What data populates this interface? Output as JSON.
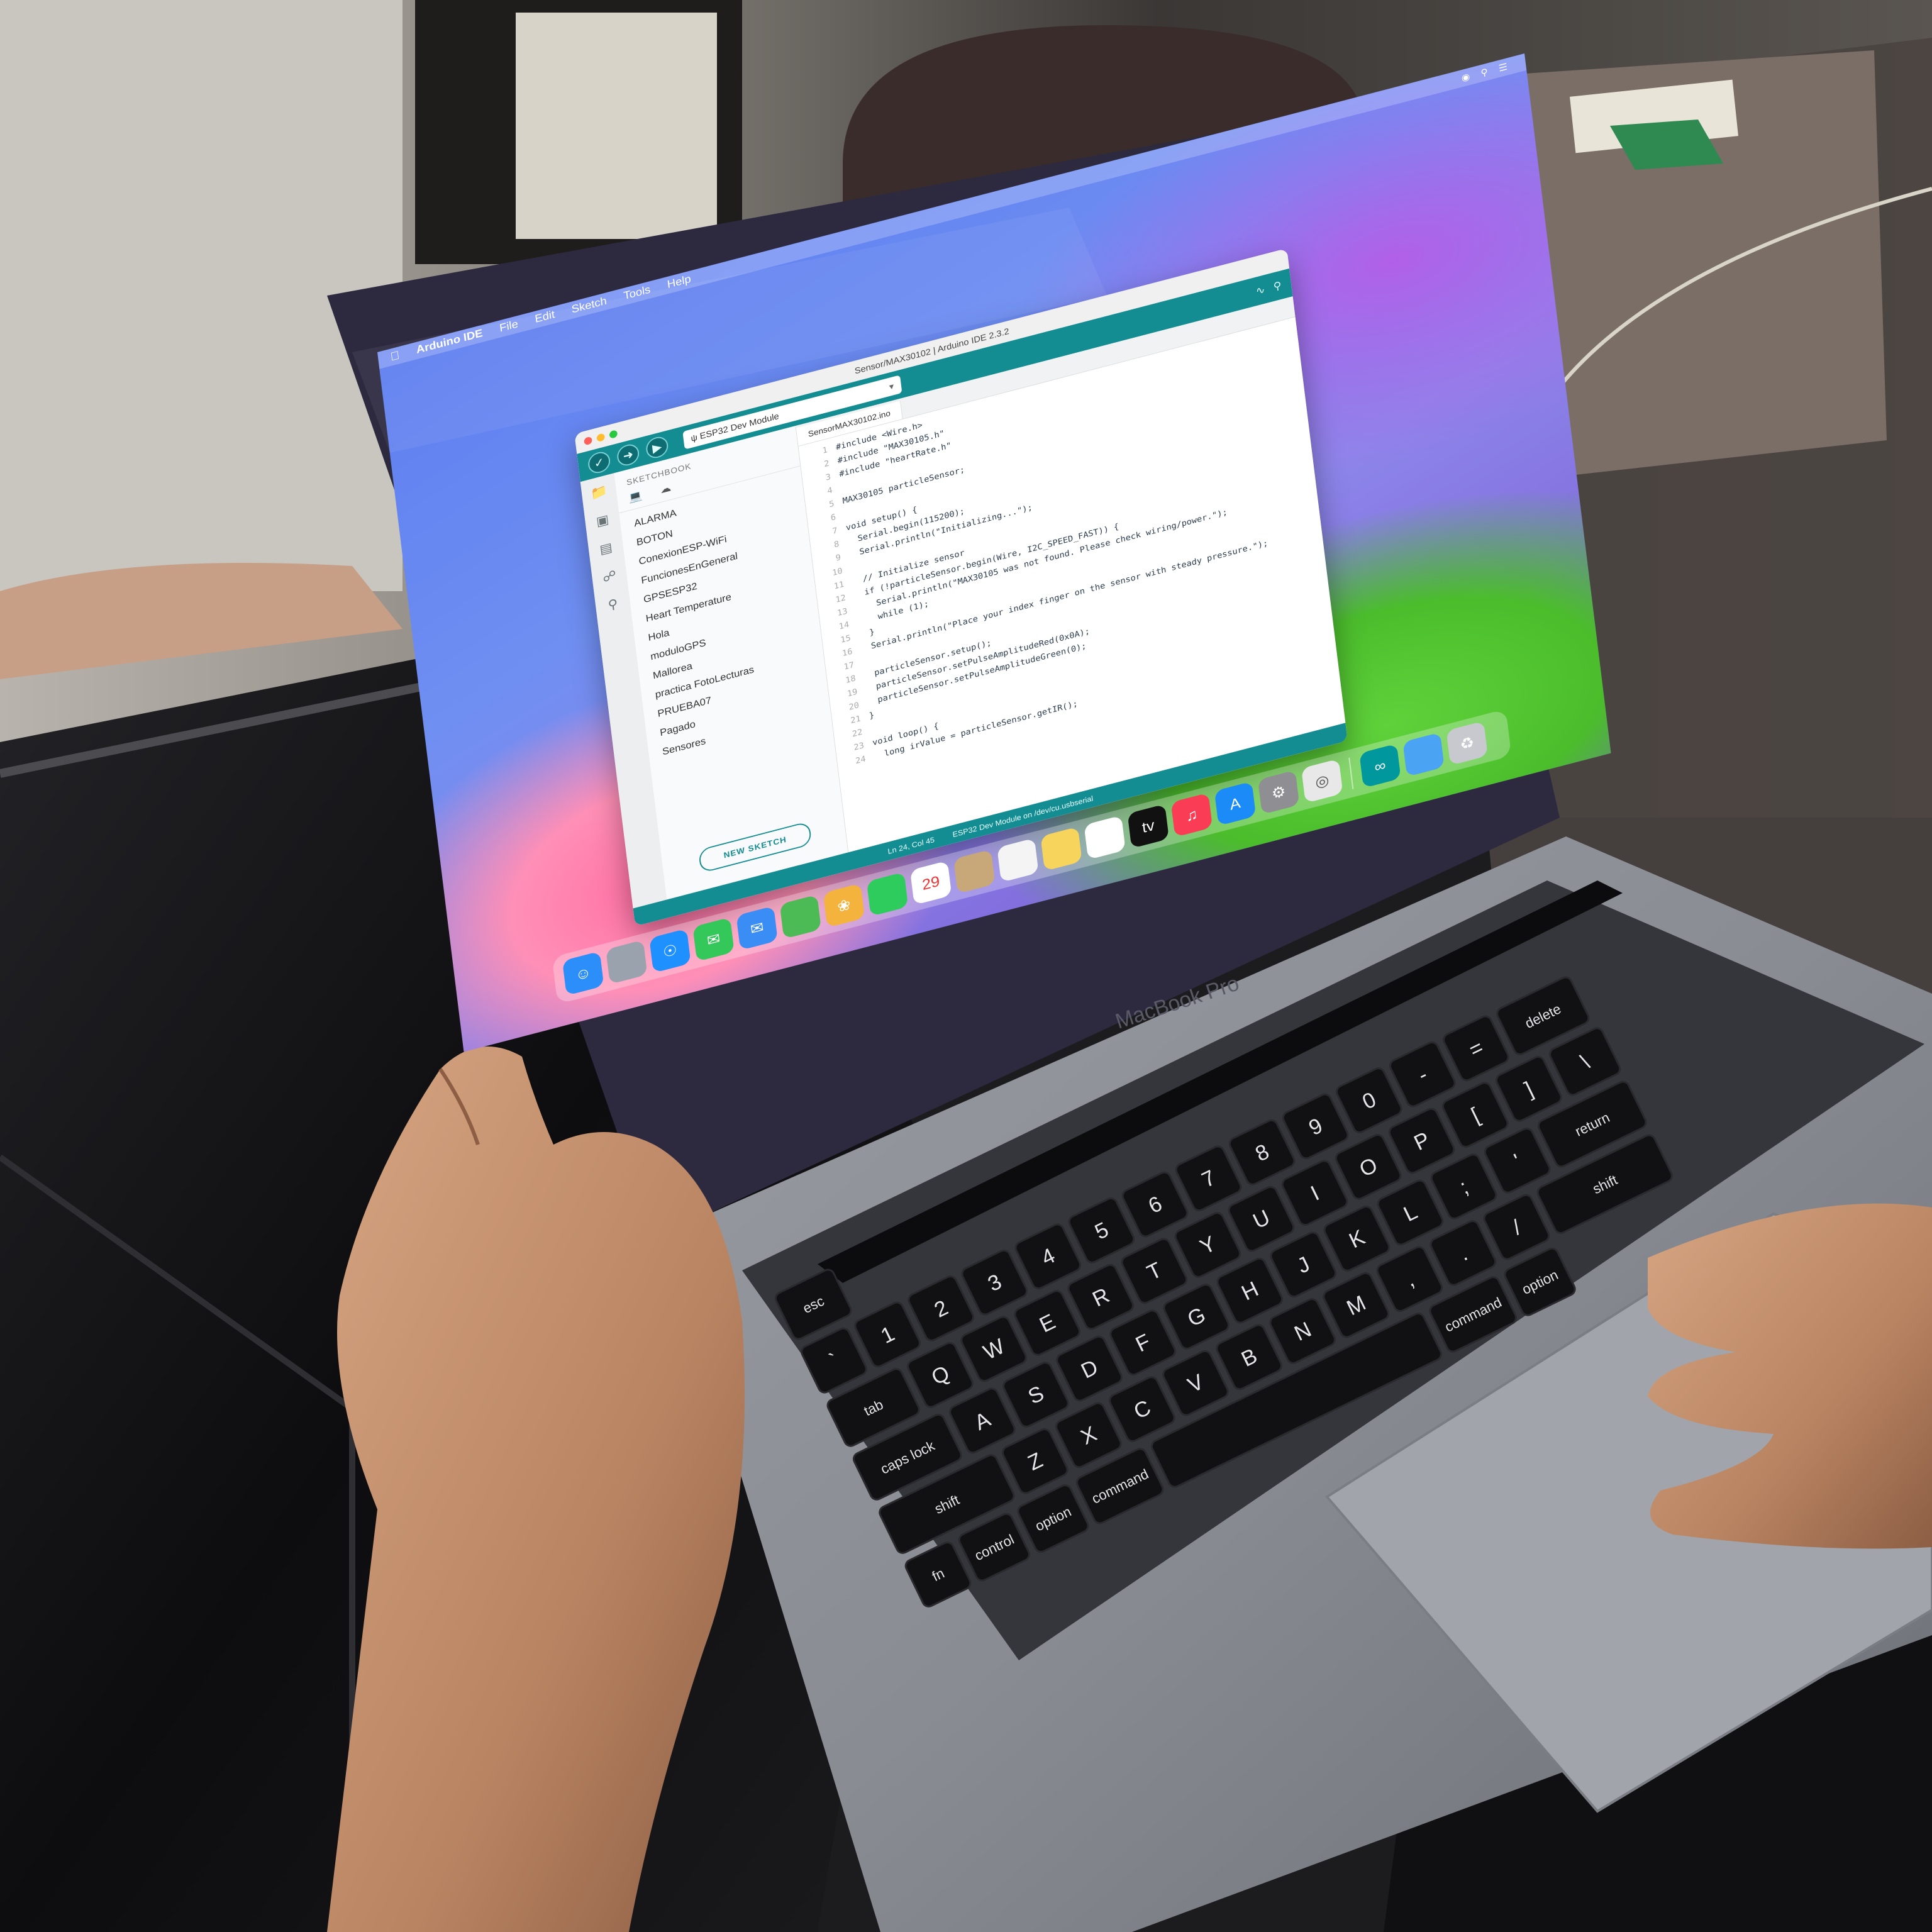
{
  "menubar": {
    "app_name": "Arduino IDE",
    "items": [
      "File",
      "Edit",
      "Sketch",
      "Tools",
      "Help"
    ]
  },
  "window": {
    "title": "Sensor/MAX30102 | Arduino IDE 2.3.2"
  },
  "toolbar": {
    "verify_icon": "check-icon",
    "upload_icon": "arrow-right-icon",
    "debug_icon": "debug-icon",
    "board": "ESP32 Dev Module"
  },
  "sidebar": {
    "header": "SKETCHBOOK",
    "items": [
      "ALARMA",
      "BOTON",
      "ConexionESP-WiFi",
      "FuncionesEnGeneral",
      "GPSESP32",
      "Heart Temperature",
      "Hola",
      "moduloGPS",
      "Mallorea",
      "practica FotoLecturas",
      "PRUEBA07",
      "Pagado",
      "Sensores"
    ],
    "new_sketch": "NEW SKETCH"
  },
  "editor": {
    "tab": "SensorMAX30102.ino",
    "lines": [
      {
        "n": "1",
        "text": "#include <Wire.h>"
      },
      {
        "n": "2",
        "text": "#include \"MAX30105.h\""
      },
      {
        "n": "3",
        "text": "#include \"heartRate.h\""
      },
      {
        "n": "4",
        "text": ""
      },
      {
        "n": "5",
        "text": "MAX30105 particleSensor;"
      },
      {
        "n": "6",
        "text": ""
      },
      {
        "n": "7",
        "text": "void setup() {"
      },
      {
        "n": "8",
        "text": "  Serial.begin(115200);"
      },
      {
        "n": "9",
        "text": "  Serial.println(\"Initializing...\");"
      },
      {
        "n": "10",
        "text": ""
      },
      {
        "n": "11",
        "text": "  // Initialize sensor"
      },
      {
        "n": "12",
        "text": "  if (!particleSensor.begin(Wire, I2C_SPEED_FAST)) {"
      },
      {
        "n": "13",
        "text": "    Serial.println(\"MAX30105 was not found. Please check wiring/power.\");"
      },
      {
        "n": "14",
        "text": "    while (1);"
      },
      {
        "n": "15",
        "text": "  }"
      },
      {
        "n": "16",
        "text": "  Serial.println(\"Place your index finger on the sensor with steady pressure.\");"
      },
      {
        "n": "17",
        "text": ""
      },
      {
        "n": "18",
        "text": "  particleSensor.setup();"
      },
      {
        "n": "19",
        "text": "  particleSensor.setPulseAmplitudeRed(0x0A);"
      },
      {
        "n": "20",
        "text": "  particleSensor.setPulseAmplitudeGreen(0);"
      },
      {
        "n": "21",
        "text": "}"
      },
      {
        "n": "22",
        "text": ""
      },
      {
        "n": "23",
        "text": "void loop() {"
      },
      {
        "n": "24",
        "text": "  long irValue = particleSensor.getIR();"
      }
    ]
  },
  "statusbar": {
    "position": "Ln 24, Col 45",
    "board_port": "ESP32 Dev Module on /dev/cu.usbserial"
  },
  "dock": {
    "icons": [
      "finder-icon",
      "launchpad-icon",
      "safari-icon",
      "messages-icon",
      "mail-icon",
      "maps-icon",
      "photos-icon",
      "facetime-icon",
      "calendar-icon",
      "contacts-icon",
      "reminders-icon",
      "notes-icon",
      "freeform-icon",
      "tv-icon",
      "music-icon",
      "app-store-icon",
      "settings-icon",
      "chrome-icon",
      "separator",
      "arduino-icon",
      "downloads-icon",
      "trash-icon"
    ],
    "calendar_day": "29"
  },
  "laptop": {
    "brand": "MacBook Pro"
  },
  "keyboard": {
    "rows": [
      [
        "esc"
      ],
      [
        "`",
        "1",
        "2",
        "3",
        "4",
        "5",
        "6",
        "7",
        "8",
        "9",
        "0",
        "-",
        "=",
        "delete"
      ],
      [
        "tab",
        "Q",
        "W",
        "E",
        "R",
        "T",
        "Y",
        "U",
        "I",
        "O",
        "P",
        "[",
        "]",
        "\\"
      ],
      [
        "caps lock",
        "A",
        "S",
        "D",
        "F",
        "G",
        "H",
        "J",
        "K",
        "L",
        ";",
        "'",
        "return"
      ],
      [
        "shift",
        "Z",
        "X",
        "C",
        "V",
        "B",
        "N",
        "M",
        ",",
        ".",
        "/",
        "shift"
      ],
      [
        "fn",
        "control",
        "option",
        "command",
        "",
        "command",
        "option"
      ]
    ]
  },
  "colors": {
    "ide_teal": "#138c92",
    "desk": "#141416",
    "laptop_silver": "#8c8e96"
  }
}
